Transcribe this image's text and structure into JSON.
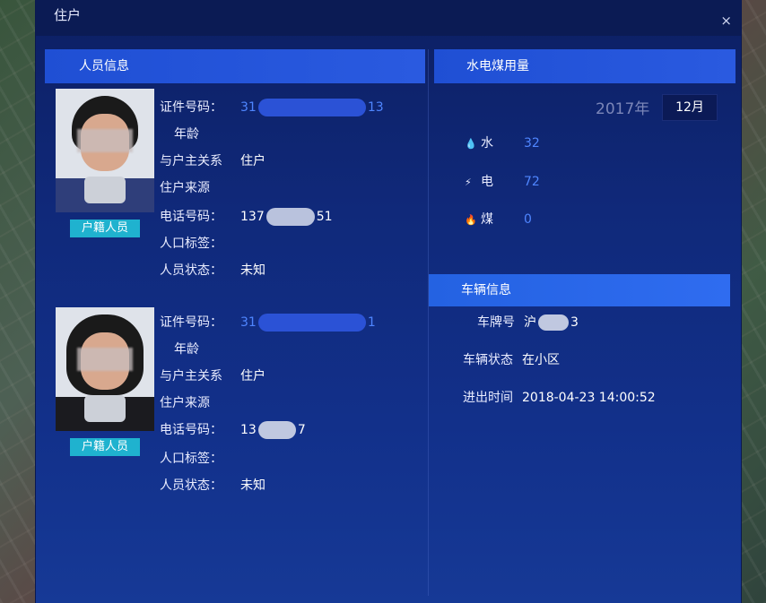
{
  "dialog": {
    "title": "住户",
    "close_icon": "×"
  },
  "left_panel": {
    "header": "人员信息",
    "persons": [
      {
        "badge": "户籍人员",
        "id_label": "证件号码：",
        "id_prefix": "31",
        "id_suffix": "13",
        "age_label": "年龄",
        "relation_label": "与户主关系",
        "relation_value": "住户",
        "source_label": "住户来源",
        "phone_label": "电话号码：",
        "phone_prefix": "137",
        "phone_suffix": "51",
        "tag_label": "人口标签：",
        "status_label": "人员状态：",
        "status_value": "未知"
      },
      {
        "badge": "户籍人员",
        "id_label": "证件号码：",
        "id_prefix": "31",
        "id_suffix": "1",
        "age_label": "年龄",
        "relation_label": "与户主关系",
        "relation_value": "住户",
        "source_label": "住户来源",
        "phone_label": "电话号码：",
        "phone_prefix": "13",
        "phone_suffix": "7",
        "tag_label": "人口标签：",
        "status_label": "人员状态：",
        "status_value": "未知"
      }
    ]
  },
  "right_panel": {
    "header": "水电煤用量",
    "year": "2017年",
    "month": "12月",
    "utilities": [
      {
        "icon": "water-drop-icon",
        "glyph": "💧",
        "name": "水",
        "value": "32"
      },
      {
        "icon": "lightning-icon",
        "glyph": "⚡",
        "name": "电",
        "value": "72"
      },
      {
        "icon": "flame-icon",
        "glyph": "🔥",
        "name": "煤",
        "value": "0"
      }
    ],
    "vehicle": {
      "header": "车辆信息",
      "plate_label": "车牌号",
      "plate_prefix": "沪",
      "plate_suffix": "3",
      "status_label": "车辆状态",
      "status_value": "在小区",
      "time_label": "进出时间",
      "time_value": "2018-04-23 14:00:52"
    }
  },
  "colors": {
    "accent": "#2a5ae0",
    "badge": "#1fb2cf",
    "value_blue": "#4f86ff",
    "dialog_bg": "#10297a"
  }
}
